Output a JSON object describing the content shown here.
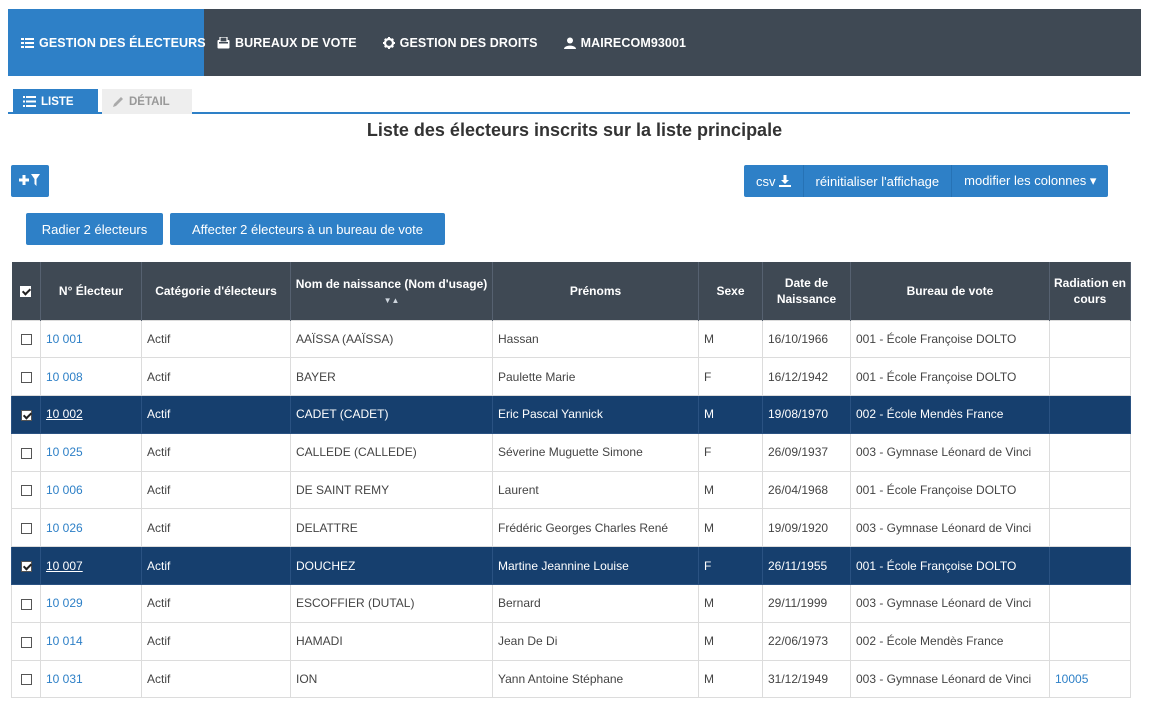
{
  "nav": {
    "items": [
      {
        "label": "GESTION DES ÉLECTEURS",
        "icon": "list-icon"
      },
      {
        "label": "BUREAUX DE VOTE",
        "icon": "ballot-box-icon"
      },
      {
        "label": "GESTION DES DROITS",
        "icon": "gear-icon"
      },
      {
        "label": "MAIRECOM93001",
        "icon": "user-icon"
      }
    ]
  },
  "subtabs": {
    "liste": "LISTE",
    "detail": "DÉTAIL"
  },
  "title": "Liste des électeurs inscrits sur la liste principale",
  "toolbar": {
    "filter_label": "+▼",
    "csv_label": "csv",
    "reset_label": "réinitialiser l'affichage",
    "columns_label": "modifier les colonnes ▾",
    "radier_label": "Radier 2 électeurs",
    "affecter_label": "Affecter 2 électeurs à un bureau de vote"
  },
  "table": {
    "headers": [
      "N° Électeur",
      "Catégorie d'électeurs",
      "Nom de naissance (Nom d'usage)",
      "Prénoms",
      "Sexe",
      "Date de Naissance",
      "Bureau de vote",
      "Radiation en cours"
    ],
    "sort_indicator": "▼▲",
    "rows": [
      {
        "checked": false,
        "num": "10 001",
        "cat": "Actif",
        "nom": "AAÏSSA (AAÏSSA)",
        "prenoms": "Hassan",
        "sexe": "M",
        "date": "16/10/1966",
        "bureau": "001 - École Françoise DOLTO",
        "radiation": ""
      },
      {
        "checked": false,
        "num": "10 008",
        "cat": "Actif",
        "nom": "BAYER",
        "prenoms": "Paulette Marie",
        "sexe": "F",
        "date": "16/12/1942",
        "bureau": "001 - École Françoise DOLTO",
        "radiation": ""
      },
      {
        "checked": true,
        "num": "10 002",
        "cat": "Actif",
        "nom": "CADET (CADET)",
        "prenoms": "Eric Pascal Yannick",
        "sexe": "M",
        "date": "19/08/1970",
        "bureau": "002 - École Mendès France",
        "radiation": ""
      },
      {
        "checked": false,
        "num": "10 025",
        "cat": "Actif",
        "nom": "CALLEDE (CALLEDE)",
        "prenoms": "Séverine Muguette Simone",
        "sexe": "F",
        "date": "26/09/1937",
        "bureau": "003 - Gymnase Léonard de Vinci",
        "radiation": ""
      },
      {
        "checked": false,
        "num": "10 006",
        "cat": "Actif",
        "nom": "DE SAINT REMY",
        "prenoms": "Laurent",
        "sexe": "M",
        "date": "26/04/1968",
        "bureau": "001 - École Françoise DOLTO",
        "radiation": ""
      },
      {
        "checked": false,
        "num": "10 026",
        "cat": "Actif",
        "nom": "DELATTRE",
        "prenoms": "Frédéric Georges Charles René",
        "sexe": "M",
        "date": "19/09/1920",
        "bureau": "003 - Gymnase Léonard de Vinci",
        "radiation": ""
      },
      {
        "checked": true,
        "num": "10 007",
        "cat": "Actif",
        "nom": "DOUCHEZ",
        "prenoms": "Martine Jeannine Louise",
        "sexe": "F",
        "date": "26/11/1955",
        "bureau": "001 - École Françoise DOLTO",
        "radiation": ""
      },
      {
        "checked": false,
        "num": "10 029",
        "cat": "Actif",
        "nom": "ESCOFFIER (DUTAL)",
        "prenoms": "Bernard",
        "sexe": "M",
        "date": "29/11/1999",
        "bureau": "003 - Gymnase Léonard de Vinci",
        "radiation": ""
      },
      {
        "checked": false,
        "num": "10 014",
        "cat": "Actif",
        "nom": "HAMADI",
        "prenoms": "Jean De Di",
        "sexe": "M",
        "date": "22/06/1973",
        "bureau": "002 - École Mendès France",
        "radiation": ""
      },
      {
        "checked": false,
        "num": "10 031",
        "cat": "Actif",
        "nom": "ION",
        "prenoms": "Yann Antoine Stéphane",
        "sexe": "M",
        "date": "31/12/1949",
        "bureau": "003 - Gymnase Léonard de Vinci",
        "radiation": "10005"
      }
    ]
  },
  "colors": {
    "nav_bg": "#3f4954",
    "accent": "#2e80c7",
    "selected_row": "#163f6e"
  }
}
